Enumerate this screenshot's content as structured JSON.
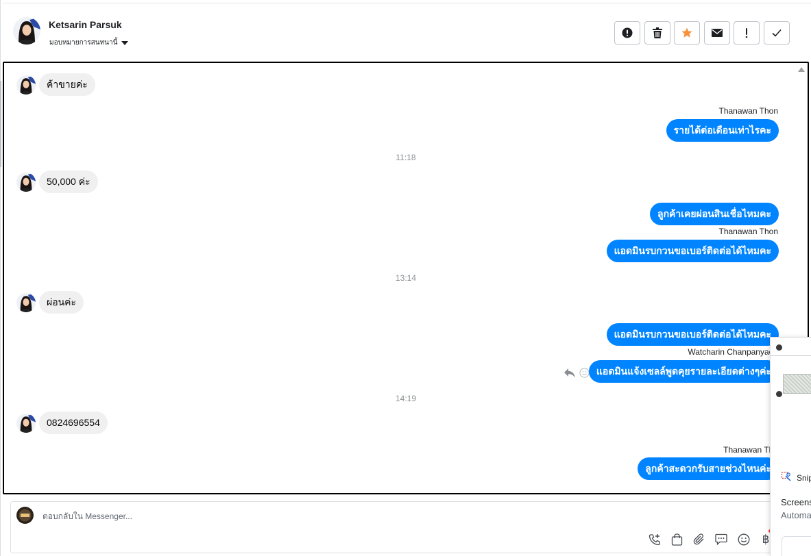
{
  "header": {
    "contact_name": "Ketsarin Parsuk",
    "assign_label": "มอบหมายการสนทนานี้",
    "actions": [
      {
        "name": "mark-spam",
        "icon": "exclamation-circle-icon"
      },
      {
        "name": "delete",
        "icon": "trash-icon"
      },
      {
        "name": "star",
        "icon": "star-icon",
        "color": "#f7923b"
      },
      {
        "name": "mark-unread",
        "icon": "envelope-icon"
      },
      {
        "name": "follow-up",
        "icon": "exclamation-icon"
      },
      {
        "name": "mark-done",
        "icon": "check-icon"
      }
    ]
  },
  "conversation": {
    "messages": [
      {
        "direction": "in",
        "text": "ค้าขายค่ะ"
      },
      {
        "direction": "out",
        "sender": "Thanawan Thon",
        "text": "รายได้ต่อเดือนเท่าไรคะ"
      },
      {
        "type": "time",
        "text": "11:18"
      },
      {
        "direction": "in",
        "text": "50,000 ค่ะ"
      },
      {
        "direction": "out",
        "text": "ลูกค้าเคยผ่อนสินเชื่อไหมคะ"
      },
      {
        "direction": "out",
        "sender": "Thanawan Thon",
        "text": "แอดมินรบกวนขอเบอร์ติดต่อได้ไหมคะ"
      },
      {
        "type": "time",
        "text": "13:14"
      },
      {
        "direction": "in",
        "text": "ผ่อนค่ะ"
      },
      {
        "direction": "out",
        "text": "แอดมินรบกวนขอเบอร์ติดต่อได้ไหมคะ"
      },
      {
        "direction": "out",
        "sender": "Watcharin Chanpanyacho",
        "text": "แอดมินแจ้งเซลล์พูดคุยรายละเอียดต่างๆค่ะ"
      },
      {
        "type": "time",
        "text": "14:19"
      },
      {
        "direction": "in",
        "text": "0824696554"
      },
      {
        "direction": "out",
        "sender": "Thanawan Tho",
        "text": "ลูกค้าสะดวกรับสายช่วงไหนค่ะ"
      }
    ]
  },
  "composer": {
    "placeholder": "ตอบกลับใน Messenger...",
    "tools": [
      "phone-add-icon",
      "shopping-bag-icon",
      "paperclip-icon",
      "chat-bubble-icon",
      "smiley-icon",
      "baht-icon"
    ],
    "baht_symbol": "฿"
  },
  "popup": {
    "app": "Snip",
    "line1": "Screens",
    "line2": "Automa"
  },
  "colors": {
    "outgoing_bubble": "#0084ff",
    "incoming_bubble": "#f0f0f0",
    "star": "#f7923b"
  }
}
